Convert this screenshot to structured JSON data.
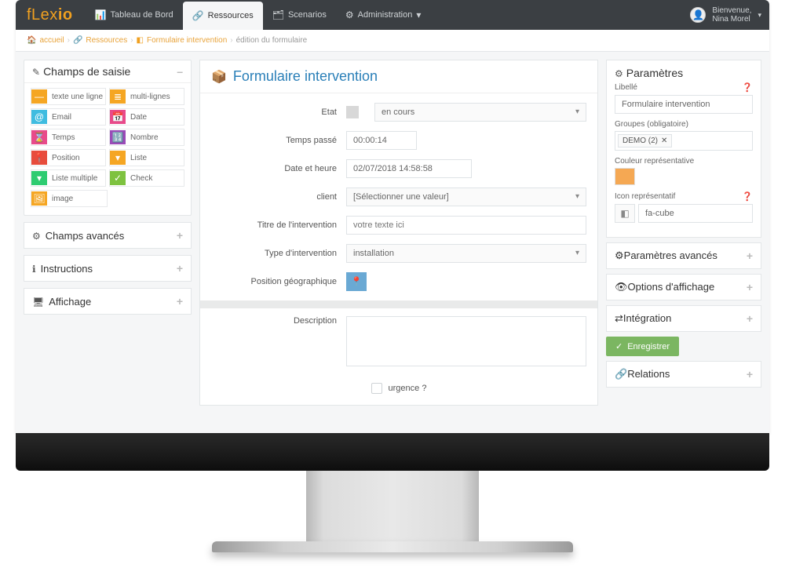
{
  "brand": {
    "prefix": "fLex",
    "suffix": "io"
  },
  "nav": {
    "dashboard": "Tableau de Bord",
    "resources": "Ressources",
    "scenarios": "Scenarios",
    "administration": "Administration"
  },
  "user": {
    "welcome": "Bienvenue,",
    "name": "Nina Morel"
  },
  "crumbs": {
    "home": "accueil",
    "res": "Ressources",
    "form": "Formulaire intervention",
    "edit": "édition du formulaire"
  },
  "left": {
    "section_fields": "Champs de saisie",
    "section_advanced": "Champs avancés",
    "section_instructions": "Instructions",
    "section_display": "Affichage",
    "types": {
      "text_line": "texte une ligne",
      "multiline": "multi-lignes",
      "email": "Email",
      "date": "Date",
      "time": "Temps",
      "number": "Nombre",
      "position": "Position",
      "list": "Liste",
      "multilist": "Liste multiple",
      "check": "Check",
      "image": "image"
    }
  },
  "form": {
    "title": "Formulaire intervention",
    "labels": {
      "etat": "Etat",
      "temps": "Temps passé",
      "datetime": "Date et heure",
      "client": "client",
      "titre_int": "Titre de l'intervention",
      "type_int": "Type d'intervention",
      "pos_geo": "Position géographique",
      "description": "Description",
      "urgence": "urgence ?"
    },
    "values": {
      "etat": "en cours",
      "temps": "00:00:14",
      "datetime": "02/07/2018 14:58:58",
      "client": "[Sélectionner une valeur]",
      "titre_int_placeholder": "votre texte ici",
      "type_int": "installation"
    }
  },
  "right": {
    "params_title": "Paramètres",
    "libelle_label": "Libellé",
    "libelle_value": "Formulaire intervention",
    "groupes_label": "Groupes (obligatoire)",
    "groupes_tag": "DEMO (2)",
    "color_label": "Couleur représentative",
    "color_value": "#f5a853",
    "icon_label": "Icon représentatif",
    "icon_value": "fa-cube",
    "adv_params": "Paramètres avancés",
    "display_opts": "Options d'affichage",
    "integration": "Intégration",
    "save": "Enregistrer",
    "relations": "Relations"
  }
}
